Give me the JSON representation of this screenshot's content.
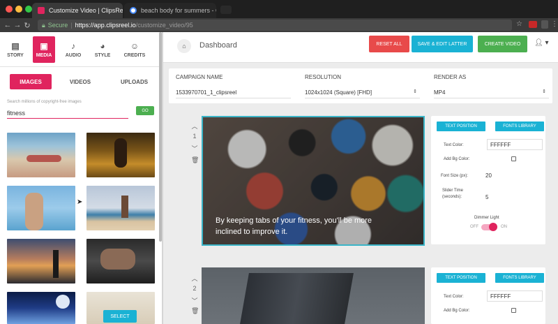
{
  "browser": {
    "tabs": [
      {
        "title": "Customize Video | ClipsReel",
        "close": "×"
      },
      {
        "title": "beach body for summers - Go",
        "close": "×"
      }
    ],
    "secure_label": "Secure",
    "url_host": "https://app.clipsreel.io",
    "url_path": "/customize_video/95"
  },
  "left": {
    "nav": [
      {
        "label": "STORY",
        "icon": "clipboard-icon"
      },
      {
        "label": "MEDIA",
        "icon": "images-icon"
      },
      {
        "label": "AUDIO",
        "icon": "music-note-icon"
      },
      {
        "label": "STYLE",
        "icon": "palette-icon"
      },
      {
        "label": "CREDITS",
        "icon": "people-icon"
      }
    ],
    "subtabs": [
      "IMAGES",
      "VIDEOS",
      "UPLOADS"
    ],
    "search_hint": "Search millions of copyright-free images",
    "search_value": "fitness",
    "go_label": "GO",
    "select_label": "SELECT"
  },
  "header": {
    "title": "Dashboard",
    "buttons": {
      "reset": "RESET ALL",
      "save": "SAVE & EDIT LATTER",
      "create": "CREATE VIDEO"
    }
  },
  "campaign": {
    "name_label": "CAMPAIGN NAME",
    "name_value": "1533970701_1_clipsreel",
    "resolution_label": "RESOLUTION",
    "resolution_value": "1024x1024 (Square) [FHD]",
    "render_label": "RENDER AS",
    "render_value": "MP4"
  },
  "slides": [
    {
      "number": "1",
      "caption": "By keeping tabs of your fitness, you'll be more inclined to improve it.",
      "text_position": "TEXT POSITION",
      "fonts_library": "FONTS LIBRARY",
      "text_color_label": "Text Color:",
      "text_color": "FFFFFF",
      "add_bg_label": "Add Bg Color:",
      "font_size_label": "Font Size (px):",
      "font_size": "20",
      "slider_time_label": "Slider Time (seconds):",
      "slider_time": "5",
      "dimmer_label": "Dimmer Light",
      "off_label": "OFF",
      "on_label": "ON"
    },
    {
      "number": "2",
      "text_position": "TEXT POSITION",
      "fonts_library": "FONTS LIBRARY",
      "text_color_label": "Text Color:",
      "text_color": "FFFFFF",
      "add_bg_label": "Add Bg Color:"
    }
  ],
  "colors": {
    "accent_pink": "#e0245e",
    "accent_cyan": "#1ab2d4",
    "reset_red": "#e84a4a",
    "create_green": "#4caf50"
  }
}
